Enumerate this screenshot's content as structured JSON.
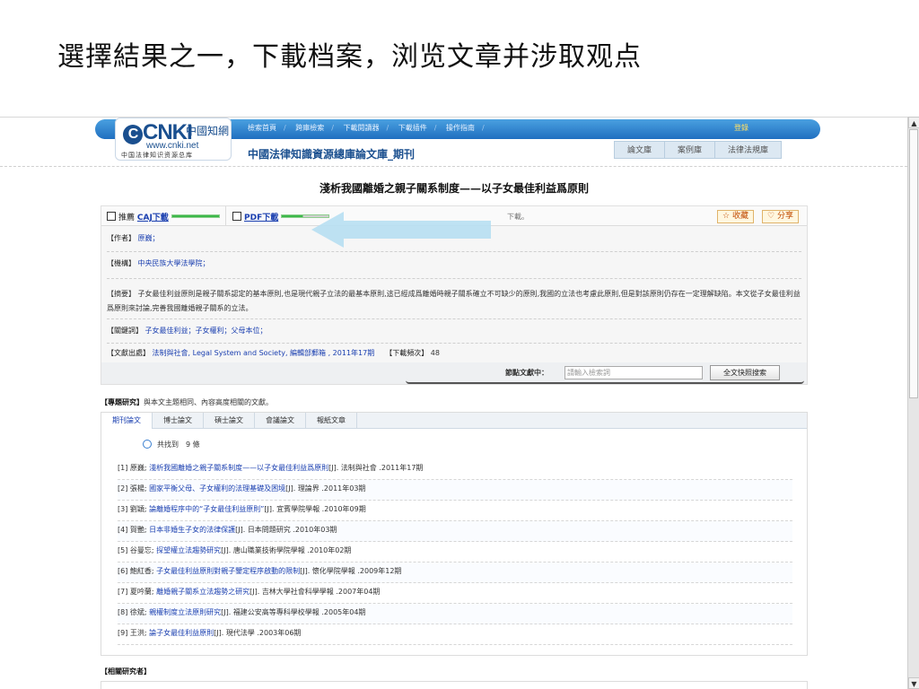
{
  "slide_title": "選擇結果之一，下載档案，浏览文章并涉取观点",
  "header": {
    "logo_text": "CNKI",
    "logo_cn": "中國知網",
    "logo_url": "www.cnki.net",
    "logo_sub": "中国法律知识资源总库",
    "nav": [
      "檢索首頁",
      "跨庫檢索",
      "下載閱讀器",
      "下載插件",
      "操作指南"
    ],
    "login": "登錄",
    "db_title": "中國法律知識資源總庫論文庫_期刊",
    "tabs": [
      "論文庫",
      "案例庫",
      "法律法規庫"
    ]
  },
  "article": {
    "title": "淺析我國離婚之親子關系制度——以子女最佳利益爲原則",
    "recommend_label": "推薦",
    "caj_label": "CAJ下載",
    "pdf_label": "PDF下載",
    "download_note": "下載。",
    "collect_label": "收藏",
    "share_label": "分享",
    "author_label": "【作者】",
    "author": "原巍；",
    "org_label": "【機構】",
    "org": "中央民族大學法學院；",
    "abstract_label": "【摘要】",
    "abstract": "子女最佳利益原則是親子關系認定的基本原則,也是現代親子立法的最基本原則,這已經成爲離婚時親子關系確立不可缺少的原則,我國的立法也考慮此原則,但是對該原則仍存在一定理解缺陷。本文從子女最佳利益爲原則來討論,完善我國離婚親子關系的立法。",
    "keywords_label": "【關鍵詞】",
    "keywords": "子女最佳利益；子女權利；父母本位；",
    "source_label": "【文獻出處】",
    "source": "法制與社會, Legal System and Society, 編輯部郵箱 , 2011年17期",
    "downloads_label": "【下載頻次】",
    "downloads": "48",
    "search_label": "節點文獻中：",
    "search_placeholder": "請輸入檢索詞",
    "search_button": "全文快照搜索"
  },
  "related": {
    "heading_label": "【專題研究】",
    "heading_desc": "與本文主題相同、內容高度相關的文獻。",
    "tabs": [
      "期刊論文",
      "博士論文",
      "碩士論文",
      "會議論文",
      "報紙文章"
    ],
    "found_label": "共找到",
    "found_count": "9 條",
    "rows": [
      {
        "prefix": "[1] 原巍;",
        "title": "淺析我國離婚之親子關系制度——以子女最佳利益爲原則",
        "suffix": "[J]. 法制與社會 .2011年17期"
      },
      {
        "prefix": "[2] 張楊;",
        "title": "國家平衡父母、子女權利的法理基礎及困境",
        "suffix": "[J]. 理論界 .2011年03期"
      },
      {
        "prefix": "[3] 劉穎;",
        "title": "論離婚程序中的“子女最佳利益原則”",
        "suffix": "[J]. 宜賓學院學報 .2010年09期"
      },
      {
        "prefix": "[4] 賀艷;",
        "title": "日本非婚生子女的法律保護",
        "suffix": "[J]. 日本問題研究 .2010年03期"
      },
      {
        "prefix": "[5] 谷曼忘;",
        "title": "探望權立法趨勢研究",
        "suffix": "[J]. 唐山職業技術學院學報 .2010年02期"
      },
      {
        "prefix": "[6] 鮑紅香;",
        "title": "子女最佳利益原則對親子鑒定程序啟動的限制",
        "suffix": "[J]. 懷化學院學報 .2009年12期"
      },
      {
        "prefix": "[7] 夏吟蘭;",
        "title": "離婚親子關系立法趨勢之研究",
        "suffix": "[J]. 吉林大學社會科學學報 .2007年04期"
      },
      {
        "prefix": "[8] 徐斌;",
        "title": "親權制度立法原則研究",
        "suffix": "[J]. 福建公安高等專科學校學報 .2005年04期"
      },
      {
        "prefix": "[9] 王洪;",
        "title": "論子女最佳利益原則",
        "suffix": "[J]. 現代法學 .2003年06期"
      }
    ]
  },
  "researchers_label": "【相關研究者】"
}
